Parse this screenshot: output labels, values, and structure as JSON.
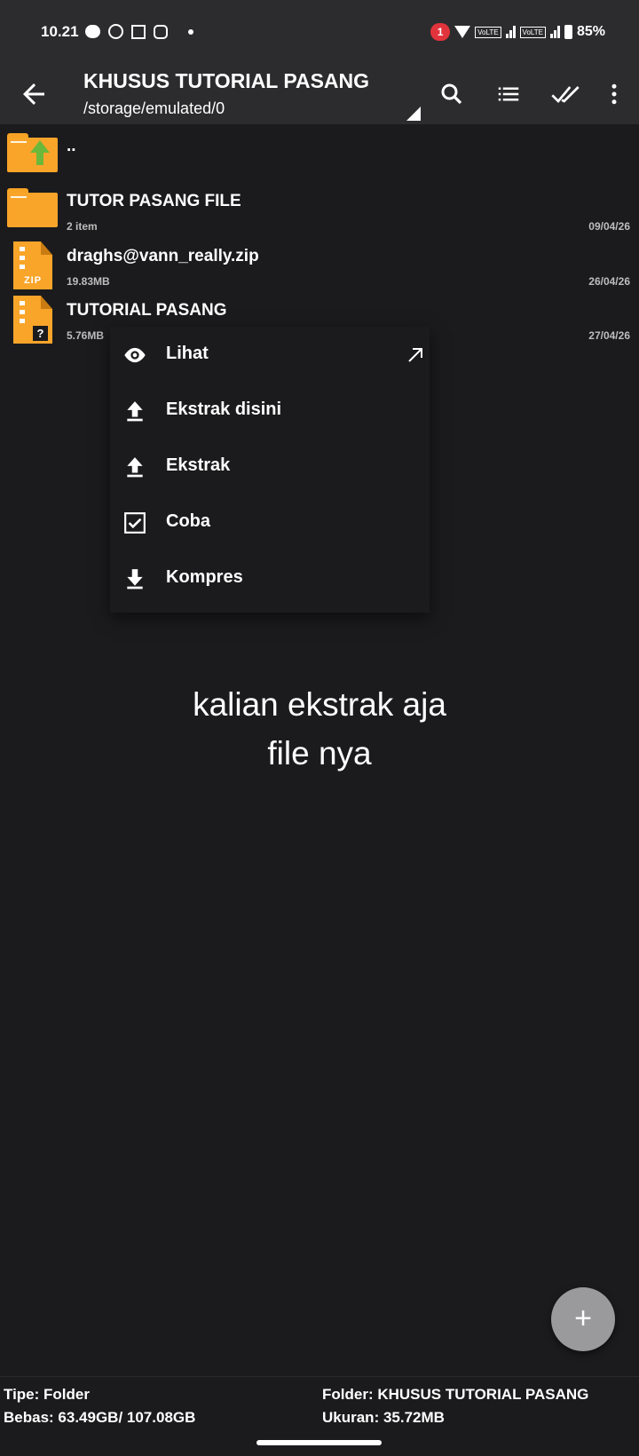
{
  "status_bar": {
    "time": "10.21",
    "notification_count": "1",
    "volte_1": "VoLTE",
    "volte_2": "VoLTE",
    "battery": "85%"
  },
  "app_bar": {
    "title": "KHUSUS TUTORIAL PASANG",
    "path": "/storage/emulated/0",
    "icons": [
      "back-arrow-icon",
      "search-icon",
      "list-view-icon",
      "select-all-icon",
      "more-vert-icon"
    ]
  },
  "files": [
    {
      "name": "..",
      "meta": "",
      "date": "",
      "icon": "folder-up-icon"
    },
    {
      "name": "TUTOR PASANG FILE",
      "meta": "2 item",
      "date": "09/04/26",
      "icon": "folder-icon"
    },
    {
      "name": "draghs@vann_really.zip",
      "meta": "19.83MB",
      "date": "26/04/26",
      "icon": "zip-file-icon",
      "badge": "ZIP"
    },
    {
      "name": "TUTORIAL PASANG",
      "meta": "5.76MB",
      "date": "27/04/26",
      "icon": "unknown-archive-icon",
      "badge": "?"
    }
  ],
  "context_menu": {
    "items": [
      {
        "label": "Lihat",
        "icon": "eye-icon"
      },
      {
        "label": "Ekstrak disini",
        "icon": "upload-icon"
      },
      {
        "label": "Ekstrak",
        "icon": "upload-icon"
      },
      {
        "label": "Coba",
        "icon": "checkbox-icon"
      },
      {
        "label": "Kompres",
        "icon": "download-icon"
      }
    ]
  },
  "caption": {
    "line1": "kalian ekstrak aja",
    "line2": "file nya"
  },
  "fab": {
    "label": "+"
  },
  "footer": {
    "type": "Tipe: Folder",
    "free": "Bebas: 63.49GB/ 107.08GB",
    "folder": "Folder: KHUSUS TUTORIAL PASANG",
    "size": "Ukuran: 35.72MB"
  },
  "colors": {
    "background": "#1b1b1d",
    "app_bar": "#2c2c2e",
    "folder": "#f9a52a",
    "up_arrow": "#6cb83a",
    "notification": "#e0333c",
    "fab": "#9a9a9c"
  }
}
